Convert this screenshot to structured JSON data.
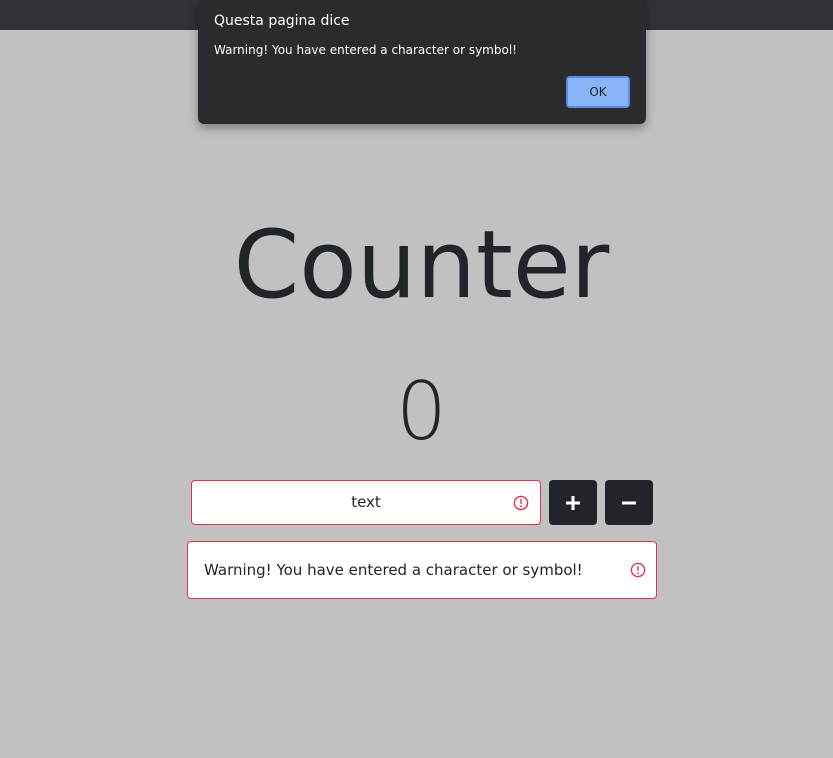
{
  "dialog": {
    "title": "Questa pagina dice",
    "message": "Warning! You have entered a character or symbol!",
    "ok_label": "OK"
  },
  "page": {
    "heading": "Counter",
    "count": "0"
  },
  "controls": {
    "input_value": "text",
    "plus_icon": "plus-icon",
    "minus_icon": "minus-icon",
    "input_state": "invalid"
  },
  "alert": {
    "message": "Warning! You have entered a character or symbol!",
    "icon": "exclamation-circle-icon"
  },
  "colors": {
    "background": "#c1c1c1",
    "dialog_bg": "#292b2f",
    "ok_button": "#8ab4f8",
    "dark_button": "#212529",
    "error": "#dc3545"
  }
}
